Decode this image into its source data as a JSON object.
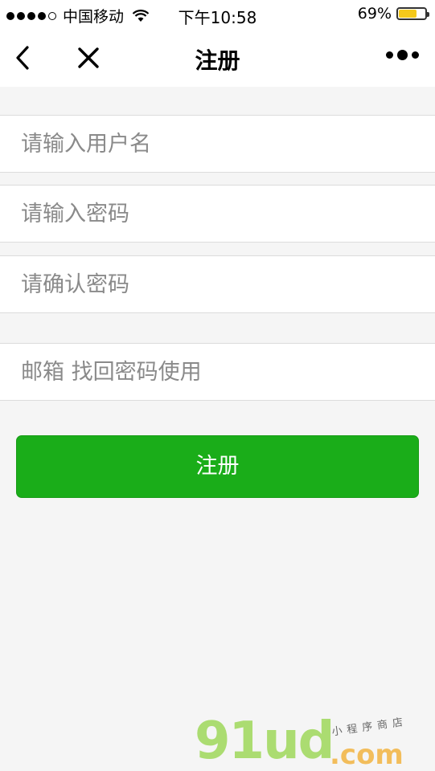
{
  "status_bar": {
    "carrier": "中国移动",
    "time": "下午10:58",
    "battery_percent": "69%",
    "battery_level": 0.69,
    "icons": [
      "signal-dots-icon",
      "wifi-icon",
      "battery-icon"
    ]
  },
  "nav": {
    "title": "注册",
    "icons": [
      "back-chevron-icon",
      "close-icon",
      "more-icon"
    ]
  },
  "form": {
    "username_placeholder": "请输入用户名",
    "password_placeholder": "请输入密码",
    "confirm_placeholder": "请确认密码",
    "email_placeholder": "邮箱 找回密码使用",
    "submit_label": "注册"
  },
  "watermark": {
    "logo": "91ud",
    "domain": ".com",
    "tagline": "小程序商店"
  },
  "colors": {
    "primary_green": "#1aad19",
    "page_background": "#f5f5f5",
    "battery_yellow": "#f4c91c"
  }
}
